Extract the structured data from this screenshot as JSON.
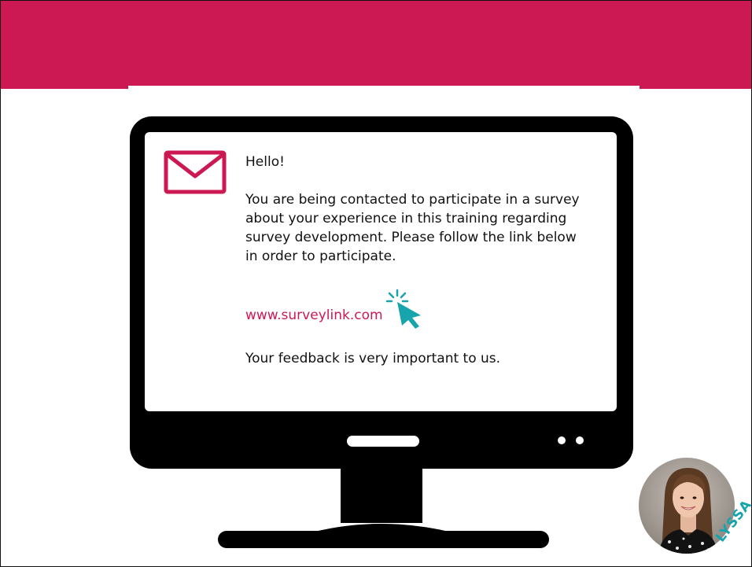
{
  "email": {
    "greeting": "Hello!",
    "body": "You are being contacted to participate in a survey about your experience in this training regarding survey development. Please follow the link below in order to participate.",
    "link": "www.surveylink.com",
    "closing": "Your feedback is very important to us."
  },
  "presenter": {
    "name": "LYSSA"
  },
  "icons": {
    "mail": "envelope-icon",
    "cursor": "click-cursor-icon"
  },
  "colors": {
    "banner": "#cc1953",
    "link": "#cc1953",
    "cursor": "#17a4ad",
    "monitor": "#000000"
  }
}
